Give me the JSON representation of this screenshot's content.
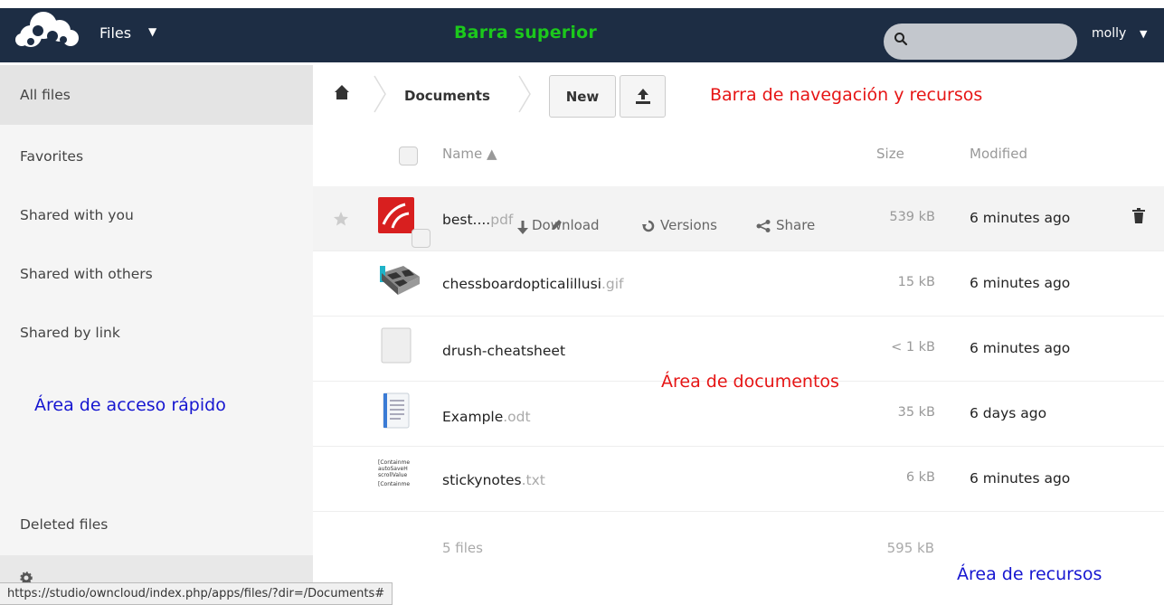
{
  "header": {
    "app_name": "Files",
    "app_caret": "▼",
    "label": "Barra superior",
    "search_placeholder": "",
    "user": "molly",
    "user_caret": "▼"
  },
  "sidebar": {
    "items": [
      {
        "label": "All files"
      },
      {
        "label": "Favorites"
      },
      {
        "label": "Shared with you"
      },
      {
        "label": "Shared with others"
      },
      {
        "label": "Shared by link"
      }
    ],
    "quick_access_label": "Área de acceso rápido",
    "deleted_files": "Deleted files"
  },
  "navbar": {
    "breadcrumb": "Documents",
    "new_button": "New",
    "label": "Barra de navegación y recursos"
  },
  "table": {
    "columns": {
      "name": "Name ▲",
      "size": "Size",
      "modified": "Modified"
    },
    "rows": [
      {
        "name": "best....",
        "ext": "pdf",
        "size": "539 kB",
        "modified": "6 minutes ago"
      },
      {
        "name": "chessboardopticalillusi",
        "ext": ".gif",
        "size": "15 kB",
        "modified": "6 minutes ago"
      },
      {
        "name": "drush-cheatsheet",
        "ext": "",
        "size": "< 1 kB",
        "modified": "6 minutes ago"
      },
      {
        "name": "Example",
        "ext": ".odt",
        "size": "35 kB",
        "modified": "6 days ago"
      },
      {
        "name": "stickynotes",
        "ext": ".txt",
        "size": "6 kB",
        "modified": "6 minutes ago"
      }
    ],
    "actions": {
      "download": "Download",
      "versions": "Versions",
      "share": "Share"
    },
    "thumb_text": [
      "[Containme",
      "autoSaveH",
      "scrollValue",
      "[Containme"
    ]
  },
  "documents_label": "Área de documentos",
  "summary": {
    "count": "5 files",
    "size": "595 kB"
  },
  "resources_label": "Área de recursos",
  "status_url": "https://studio/owncloud/index.php/apps/files/?dir=/Documents#",
  "colors": {
    "header_bg": "#1d2d44",
    "green_label": "#1cc81c",
    "red_label": "#e61515",
    "blue_label": "#1616d0"
  }
}
